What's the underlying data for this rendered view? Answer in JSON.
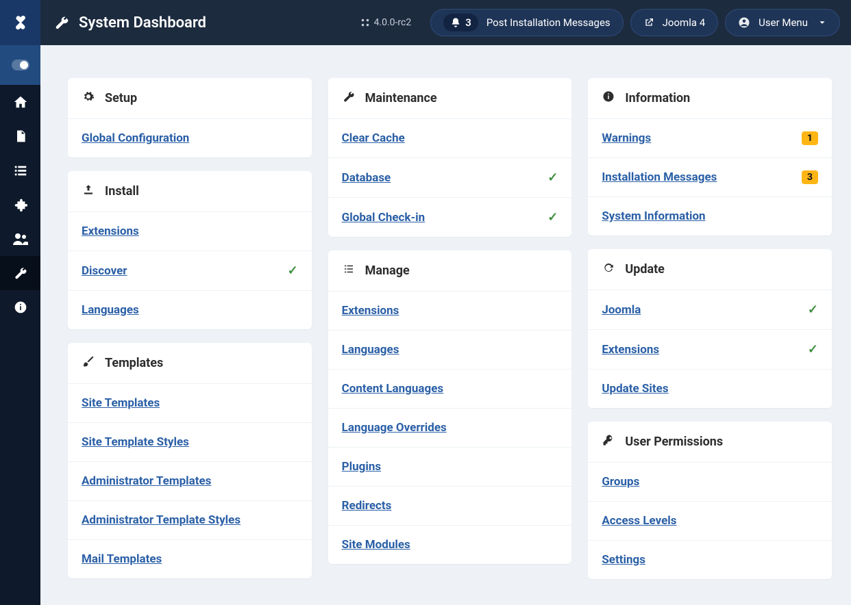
{
  "header": {
    "title": "System Dashboard",
    "version": "4.0.0-rc2",
    "notif_count": "3",
    "notif_label": "Post Installation Messages",
    "launch_label": "Joomla 4",
    "user_menu_label": "User Menu"
  },
  "cards": {
    "setup": {
      "title": "Setup",
      "items": [
        {
          "label": "Global Configuration"
        }
      ]
    },
    "install": {
      "title": "Install",
      "items": [
        {
          "label": "Extensions"
        },
        {
          "label": "Discover",
          "check": true
        },
        {
          "label": "Languages"
        }
      ]
    },
    "templates": {
      "title": "Templates",
      "items": [
        {
          "label": "Site Templates"
        },
        {
          "label": "Site Template Styles"
        },
        {
          "label": "Administrator Templates"
        },
        {
          "label": "Administrator Template Styles"
        },
        {
          "label": "Mail Templates"
        }
      ]
    },
    "maintenance": {
      "title": "Maintenance",
      "items": [
        {
          "label": "Clear Cache"
        },
        {
          "label": "Database",
          "check": true
        },
        {
          "label": "Global Check-in",
          "check": true
        }
      ]
    },
    "manage": {
      "title": "Manage",
      "items": [
        {
          "label": "Extensions"
        },
        {
          "label": "Languages"
        },
        {
          "label": "Content Languages"
        },
        {
          "label": "Language Overrides"
        },
        {
          "label": "Plugins"
        },
        {
          "label": "Redirects"
        },
        {
          "label": "Site Modules"
        }
      ]
    },
    "information": {
      "title": "Information",
      "items": [
        {
          "label": "Warnings",
          "badge": "1"
        },
        {
          "label": "Installation Messages",
          "badge": "3"
        },
        {
          "label": "System Information"
        }
      ]
    },
    "update": {
      "title": "Update",
      "items": [
        {
          "label": "Joomla",
          "check": true
        },
        {
          "label": "Extensions",
          "check": true
        },
        {
          "label": "Update Sites"
        }
      ]
    },
    "permissions": {
      "title": "User Permissions",
      "items": [
        {
          "label": "Groups"
        },
        {
          "label": "Access Levels"
        },
        {
          "label": "Settings"
        }
      ]
    }
  }
}
